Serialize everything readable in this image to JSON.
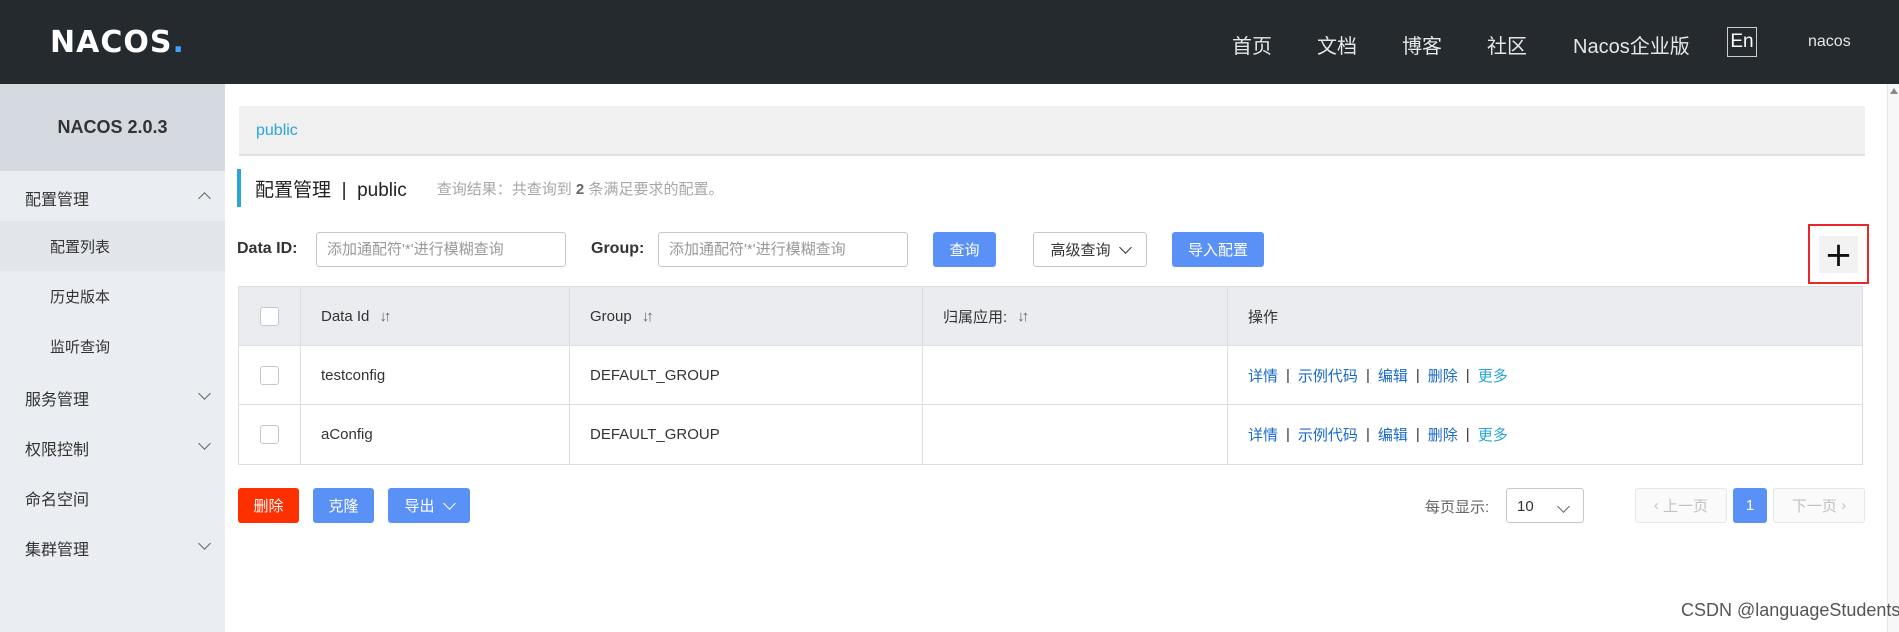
{
  "header": {
    "logo": "NACOS",
    "logo_dot": ".",
    "nav": [
      "首页",
      "文档",
      "博客",
      "社区",
      "Nacos企业版"
    ],
    "lang": "En",
    "user": "nacos"
  },
  "sidebar": {
    "title": "NACOS 2.0.3",
    "items": [
      {
        "label": "配置管理",
        "expanded": true
      },
      {
        "label": "配置列表",
        "active": true
      },
      {
        "label": "历史版本"
      },
      {
        "label": "监听查询"
      },
      {
        "label": "服务管理"
      },
      {
        "label": "权限控制"
      },
      {
        "label": "命名空间"
      },
      {
        "label": "集群管理"
      }
    ]
  },
  "main": {
    "namespace_tab": "public",
    "page_title": "配置管理",
    "title_sep": "|",
    "title_namespace": "public",
    "result_prefix": "查询结果：共查询到",
    "result_count": "2",
    "result_suffix": "条满足要求的配置。",
    "filters": {
      "dataid_label": "Data ID:",
      "dataid_placeholder": "添加通配符'*'进行模糊查询",
      "group_label": "Group:",
      "group_placeholder": "添加通配符'*'进行模糊查询",
      "query_button": "查询",
      "advanced_button": "高级查询",
      "import_button": "导入配置",
      "add_button": "+"
    },
    "table": {
      "headers": [
        "Data Id",
        "Group",
        "归属应用:",
        "操作"
      ],
      "sort_icon": "↓↑",
      "rows": [
        {
          "data_id": "testconfig",
          "group": "DEFAULT_GROUP",
          "app": ""
        },
        {
          "data_id": "aConfig",
          "group": "DEFAULT_GROUP",
          "app": ""
        }
      ],
      "actions": [
        "详情",
        "示例代码",
        "编辑",
        "删除",
        "更多"
      ],
      "action_sep": "|"
    },
    "bottom": {
      "delete_button": "删除",
      "clone_button": "克隆",
      "export_button": "导出"
    },
    "pagination": {
      "per_page_label": "每页显示:",
      "per_page_value": "10",
      "prev": "上一页",
      "current": "1",
      "next": "下一页"
    }
  },
  "watermark": "CSDN @languageStudents",
  "colors": {
    "header_bg": "#252a2f",
    "sidebar_bg": "#eaedf1",
    "primary": "#5a91f7",
    "danger": "#ff3000",
    "accent": "#29a5d7",
    "link": "#1a6ac8",
    "highlight_box": "#e8262b"
  }
}
